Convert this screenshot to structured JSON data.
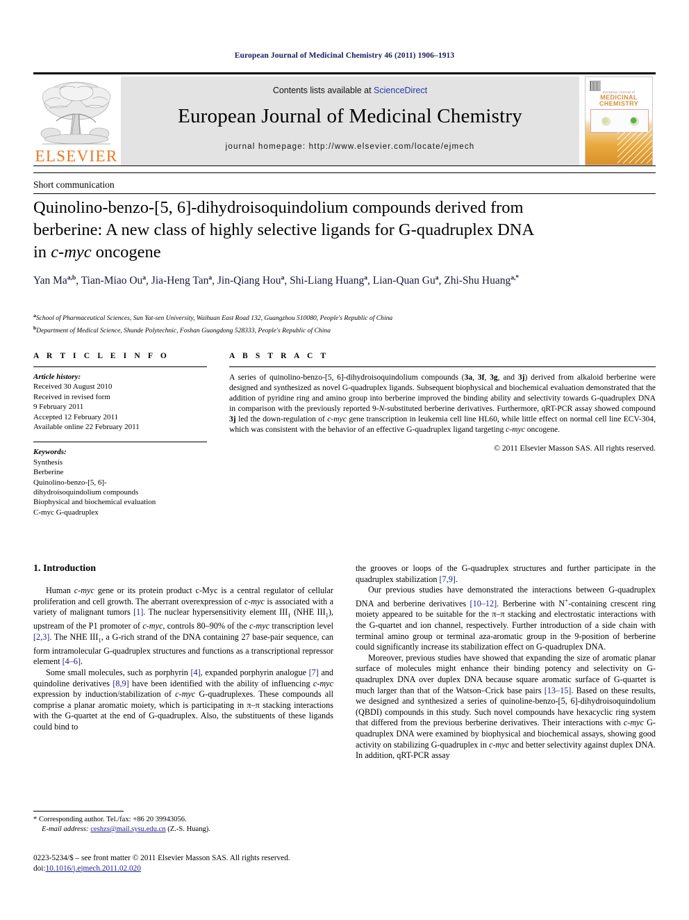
{
  "running_head": "European Journal of Medicinal Chemistry 46 (2011) 1906–1913",
  "masthead": {
    "publisher_name": "ELSEVIER",
    "contents_prefix": "Contents lists available at ",
    "sciencedirect": "ScienceDirect",
    "journal_title": "European Journal of Medicinal Chemistry",
    "homepage": "journal homepage: http://www.elsevier.com/locate/ejmech",
    "cover": {
      "journal_small": "European Journal of",
      "line1": "MEDICINAL",
      "line2": "CHEMISTRY"
    },
    "colors": {
      "elsevier_orange": "#E87722",
      "band_gray": "#e3e3e3",
      "link_blue": "#2b35a8"
    }
  },
  "article": {
    "type_label": "Short communication",
    "title_line1": "Quinolino-benzo-[5, 6]-dihydroisoquindolium compounds derived from",
    "title_line2": "berberine: A new class of highly selective ligands for G-quadruplex DNA",
    "title_line3_pre": "in ",
    "title_line3_italic": "c-myc",
    "title_line3_post": " oncogene",
    "authors": [
      {
        "name": "Yan Ma",
        "sup": "a,b"
      },
      {
        "name": "Tian-Miao Ou",
        "sup": "a"
      },
      {
        "name": "Jia-Heng Tan",
        "sup": "a"
      },
      {
        "name": "Jin-Qiang Hou",
        "sup": "a"
      },
      {
        "name": "Shi-Liang Huang",
        "sup": "a"
      },
      {
        "name": "Lian-Quan Gu",
        "sup": "a"
      },
      {
        "name": "Zhi-Shu Huang",
        "sup": "a,*"
      }
    ],
    "affiliations": [
      {
        "marker": "a",
        "text": "School of Pharmaceutical Sciences, Sun Yat-sen University, Waihuan East Road 132, Guangzhou 510080, People's Republic of China"
      },
      {
        "marker": "b",
        "text": "Department of Medical Science, Shunde Polytechnic, Foshan Guangdong 528333, People's Republic of China"
      }
    ]
  },
  "article_info": {
    "heading": "A R T I C L E    I N F O",
    "history_heading": "Article history:",
    "history": [
      "Received 30 August 2010",
      "Received in revised form",
      "9 February 2011",
      "Accepted 12 February 2011",
      "Available online 22 February 2011"
    ],
    "keywords_heading": "Keywords:",
    "keywords": [
      "Synthesis",
      "Berberine",
      "Quinolino-benzo-[5, 6]-",
      "dihydroisoquindolium compounds",
      "Biophysical and biochemical evaluation",
      "C-myc G-quadruplex"
    ]
  },
  "abstract": {
    "heading": "A B S T R A C T",
    "paragraph_html": "A series of quinolino-benzo-[5, 6]-dihydroisoquindolium compounds (<b>3a</b>, <b>3f</b>, <b>3g</b>, and <b>3j</b>) derived from alkaloid berberine were designed and synthesized as novel G-quadruplex ligands. Subsequent biophysical and biochemical evaluation demonstrated that the addition of pyridine ring and amino group into berberine improved the binding ability and selectivity towards G-quadruplex DNA in comparison with the previously reported 9-<i>N</i>-substituted berberine derivatives. Furthermore, qRT-PCR assay showed compound <b>3j</b> led the down-regulation of <i>c-myc</i> gene transcription in leukemia cell line HL60, while little effect on normal cell line ECV-304, which was consistent with the behavior of an effective G-quadruplex ligand targeting <i>c-myc</i> oncogene.",
    "copyright": "© 2011 Elsevier Masson SAS. All rights reserved."
  },
  "body": {
    "section_number_title": "1.  Introduction",
    "left_paragraphs_html": [
      "Human <i>c-myc</i> gene or its protein product c-Myc is a central regulator of cellular proliferation and cell growth. The aberrant overexpression of <i>c-myc</i> is associated with a variety of malignant tumors <span class=\"ref\">[1]</span>. The nuclear hypersensitivity element III<sub>1</sub> (NHE III<sub>1</sub>), upstream of the P1 promoter of <i>c-myc</i>, controls 80–90% of the <i>c-myc</i> transcription level <span class=\"ref\">[2,3]</span>. The NHE III<sub>1</sub>, a G-rich strand of the DNA containing 27 base-pair sequence, can form intramolecular G-quadruplex structures and functions as a transcriptional repressor element <span class=\"ref\">[4–6]</span>.",
      "Some small molecules, such as porphyrin <span class=\"ref\">[4]</span>, expanded porphyrin analogue <span class=\"ref\">[7]</span> and quindoline derivatives <span class=\"ref\">[8,9]</span> have been identified with the ability of influencing <i>c-myc</i> expression by induction/stabilization of <i>c-myc</i> G-quadruplexes. These compounds all comprise a planar aromatic moiety, which is participating in π–π stacking interactions with the G-quartet at the end of G-quadruplex. Also, the substituents of these ligands could bind to"
    ],
    "right_paragraphs_html": [
      "the grooves or loops of the G-quadruplex structures and further participate in the quadruplex stabilization <span class=\"ref\">[7,9]</span>.",
      "Our previous studies have demonstrated the interactions between G-quadruplex DNA and berberine derivatives <span class=\"ref\">[10–12]</span>. Berberine with N<sup class=\"plus\">+</sup>-containing crescent ring moiety appeared to be suitable for the π–π stacking and electrostatic interactions with the G-quartet and ion channel, respectively. Further introduction of a side chain with terminal amino group or terminal aza-aromatic group in the 9-position of berberine could significantly increase its stabilization effect on G-quadruplex DNA.",
      "Moreover, previous studies have showed that expanding the size of aromatic planar surface of molecules might enhance their binding potency and selectivity on G-quadruplex DNA over duplex DNA because square aromatic surface of G-quartet is much larger than that of the Watson–Crick base pairs <span class=\"ref\">[13–15]</span>. Based on these results, we designed and synthesized a series of quinoline-benzo-[5, 6]-dihydroisoquindolium (QBDI) compounds in this study. Such novel compounds have hexacyclic ring system that differed from the previous berberine derivatives. Their interactions with <i>c-myc</i> G-quadruplex DNA were examined by biophysical and biochemical assays, showing good activity on stabilizing G-quadruplex in <i>c-myc</i> and better selectivity against duplex DNA. In addition, qRT-PCR assay"
    ]
  },
  "footnote": {
    "corresponding_html": "* Corresponding author. Tel./fax: +86 20 39943056.",
    "email_label": "E-mail address:",
    "email": "ceshzs@mail.sysu.edu.cn",
    "email_owner": "(Z.-S. Huang)."
  },
  "issn_line": {
    "text_html": "0223-5234/$ – see front matter © 2011 Elsevier Masson SAS. All rights reserved.",
    "doi_prefix": "doi:",
    "doi": "10.1016/j.ejmech.2011.02.020"
  }
}
